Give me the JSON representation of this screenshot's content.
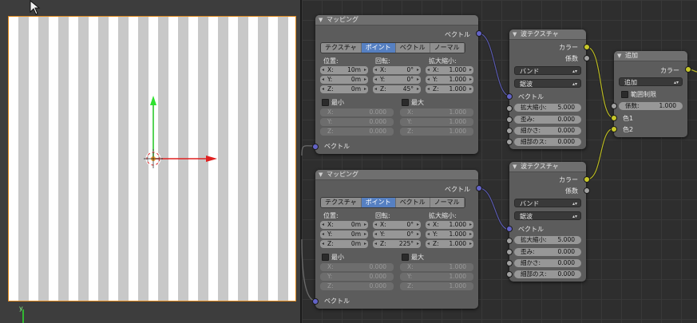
{
  "viewport": {
    "axis_label": "y",
    "colors": {
      "plane_border": "#e08a1e",
      "stripe_light": "#ffffff",
      "stripe_dark": "#c8c8c8"
    }
  },
  "mapping_nodes": [
    {
      "title": "マッピング",
      "out_vector": "ベクトル",
      "tabs": [
        "テクスチャ",
        "ポイント",
        "ベクトル",
        "ノーマル"
      ],
      "active_tab": "ポイント",
      "loc_label": "位置:",
      "rot_label": "回転:",
      "scale_label": "拡大縮小:",
      "loc": [
        {
          "k": "X:",
          "v": "10m"
        },
        {
          "k": "Y:",
          "v": "0m"
        },
        {
          "k": "Z:",
          "v": "0m"
        }
      ],
      "rot": [
        {
          "k": "X:",
          "v": "0°"
        },
        {
          "k": "Y:",
          "v": "0°"
        },
        {
          "k": "Z:",
          "v": "45°"
        }
      ],
      "scale": [
        {
          "k": "X:",
          "v": "1.000"
        },
        {
          "k": "Y:",
          "v": "1.000"
        },
        {
          "k": "Z:",
          "v": "1.000"
        }
      ],
      "min_label": "最小",
      "max_label": "最大",
      "min": [
        {
          "k": "X:",
          "v": "0.000"
        },
        {
          "k": "Y:",
          "v": "0.000"
        },
        {
          "k": "Z:",
          "v": "0.000"
        }
      ],
      "max": [
        {
          "k": "X:",
          "v": "1.000"
        },
        {
          "k": "Y:",
          "v": "1.000"
        },
        {
          "k": "Z:",
          "v": "1.000"
        }
      ],
      "in_vector": "ベクトル"
    },
    {
      "title": "マッピング",
      "out_vector": "ベクトル",
      "tabs": [
        "テクスチャ",
        "ポイント",
        "ベクトル",
        "ノーマル"
      ],
      "active_tab": "ポイント",
      "loc_label": "位置:",
      "rot_label": "回転:",
      "scale_label": "拡大縮小:",
      "loc": [
        {
          "k": "X:",
          "v": "0m"
        },
        {
          "k": "Y:",
          "v": "0m"
        },
        {
          "k": "Z:",
          "v": "0m"
        }
      ],
      "rot": [
        {
          "k": "X:",
          "v": "0°"
        },
        {
          "k": "Y:",
          "v": "0°"
        },
        {
          "k": "Z:",
          "v": "225°"
        }
      ],
      "scale": [
        {
          "k": "X:",
          "v": "1.000"
        },
        {
          "k": "Y:",
          "v": "1.000"
        },
        {
          "k": "Z:",
          "v": "1.000"
        }
      ],
      "min_label": "最小",
      "max_label": "最大",
      "min": [
        {
          "k": "X:",
          "v": "0.000"
        },
        {
          "k": "Y:",
          "v": "0.000"
        },
        {
          "k": "Z:",
          "v": "0.000"
        }
      ],
      "max": [
        {
          "k": "X:",
          "v": "1.000"
        },
        {
          "k": "Y:",
          "v": "1.000"
        },
        {
          "k": "Z:",
          "v": "1.000"
        }
      ],
      "in_vector": "ベクトル"
    }
  ],
  "wave_nodes": [
    {
      "title": "波テクスチャ",
      "out_color": "カラー",
      "out_fac": "係数",
      "type": "バンド",
      "profile": "鋸波",
      "in_vector": "ベクトル",
      "inputs": [
        {
          "k": "拡大縮小:",
          "v": "5.000"
        },
        {
          "k": "歪み:",
          "v": "0.000"
        },
        {
          "k": "細かさ:",
          "v": "0.000"
        },
        {
          "k": "細部のス:",
          "v": "0.000"
        }
      ]
    },
    {
      "title": "波テクスチャ",
      "out_color": "カラー",
      "out_fac": "係数",
      "type": "バンド",
      "profile": "鋸波",
      "in_vector": "ベクトル",
      "inputs": [
        {
          "k": "拡大縮小:",
          "v": "5.000"
        },
        {
          "k": "歪み:",
          "v": "0.000"
        },
        {
          "k": "細かさ:",
          "v": "0.000"
        },
        {
          "k": "細部のス:",
          "v": "0.000"
        }
      ]
    }
  ],
  "mix_node": {
    "title": "追加",
    "out_color": "カラー",
    "blend": "追加",
    "clamp_label": "範囲制限",
    "fac_label": "係数:",
    "fac_value": "1.000",
    "color1": "色1",
    "color2": "色2"
  }
}
